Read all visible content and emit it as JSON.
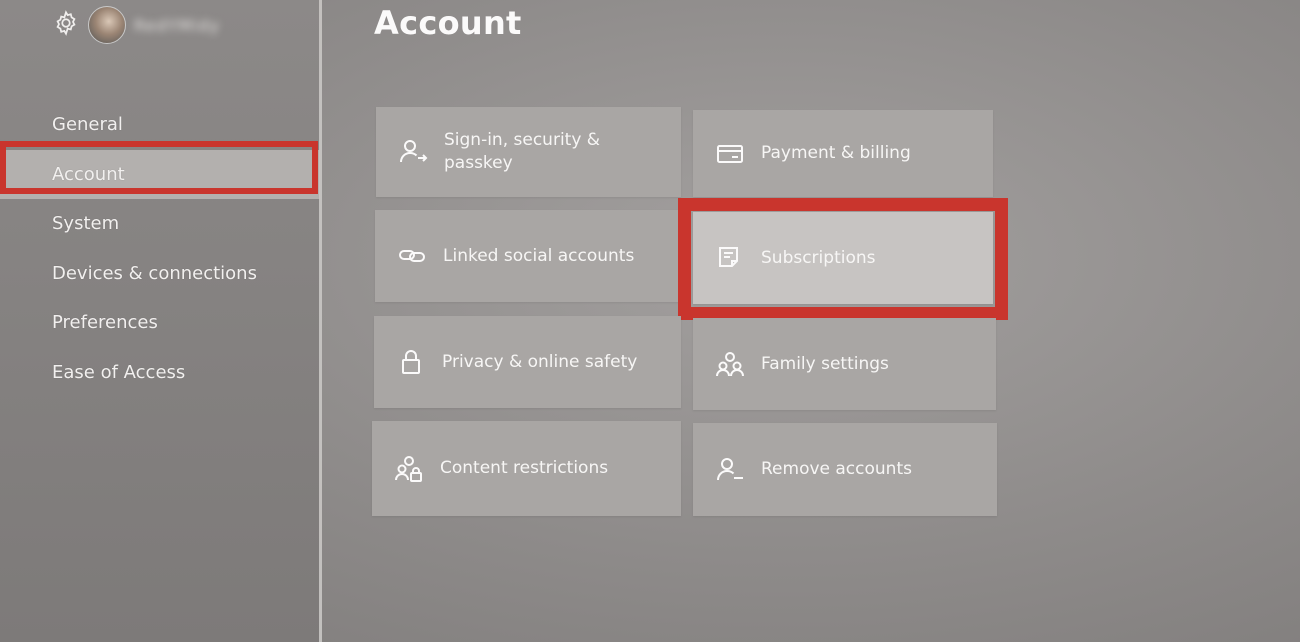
{
  "header": {
    "title": "Account",
    "gamertag": "RedYMidy"
  },
  "nav": {
    "items": [
      {
        "id": "general",
        "label": "General"
      },
      {
        "id": "account",
        "label": "Account",
        "selected": true
      },
      {
        "id": "system",
        "label": "System"
      },
      {
        "id": "devices",
        "label": "Devices & connections"
      },
      {
        "id": "preferences",
        "label": "Preferences"
      },
      {
        "id": "ease",
        "label": "Ease of Access"
      }
    ]
  },
  "tiles": {
    "signin": {
      "label": "Sign-in, security & passkey",
      "icon": "person-arrow-icon"
    },
    "payment": {
      "label": "Payment & billing",
      "icon": "credit-card-icon"
    },
    "linked": {
      "label": "Linked social accounts",
      "icon": "link-icon"
    },
    "subscriptions": {
      "label": "Subscriptions",
      "icon": "subscriptions-icon",
      "focused": true
    },
    "privacy": {
      "label": "Privacy & online safety",
      "icon": "lock-icon"
    },
    "family": {
      "label": "Family settings",
      "icon": "family-icon"
    },
    "content": {
      "label": "Content restrictions",
      "icon": "people-lock-icon"
    },
    "remove": {
      "label": "Remove accounts",
      "icon": "person-minus-icon"
    }
  },
  "annotations": {
    "highlight_color": "#c9352d"
  }
}
